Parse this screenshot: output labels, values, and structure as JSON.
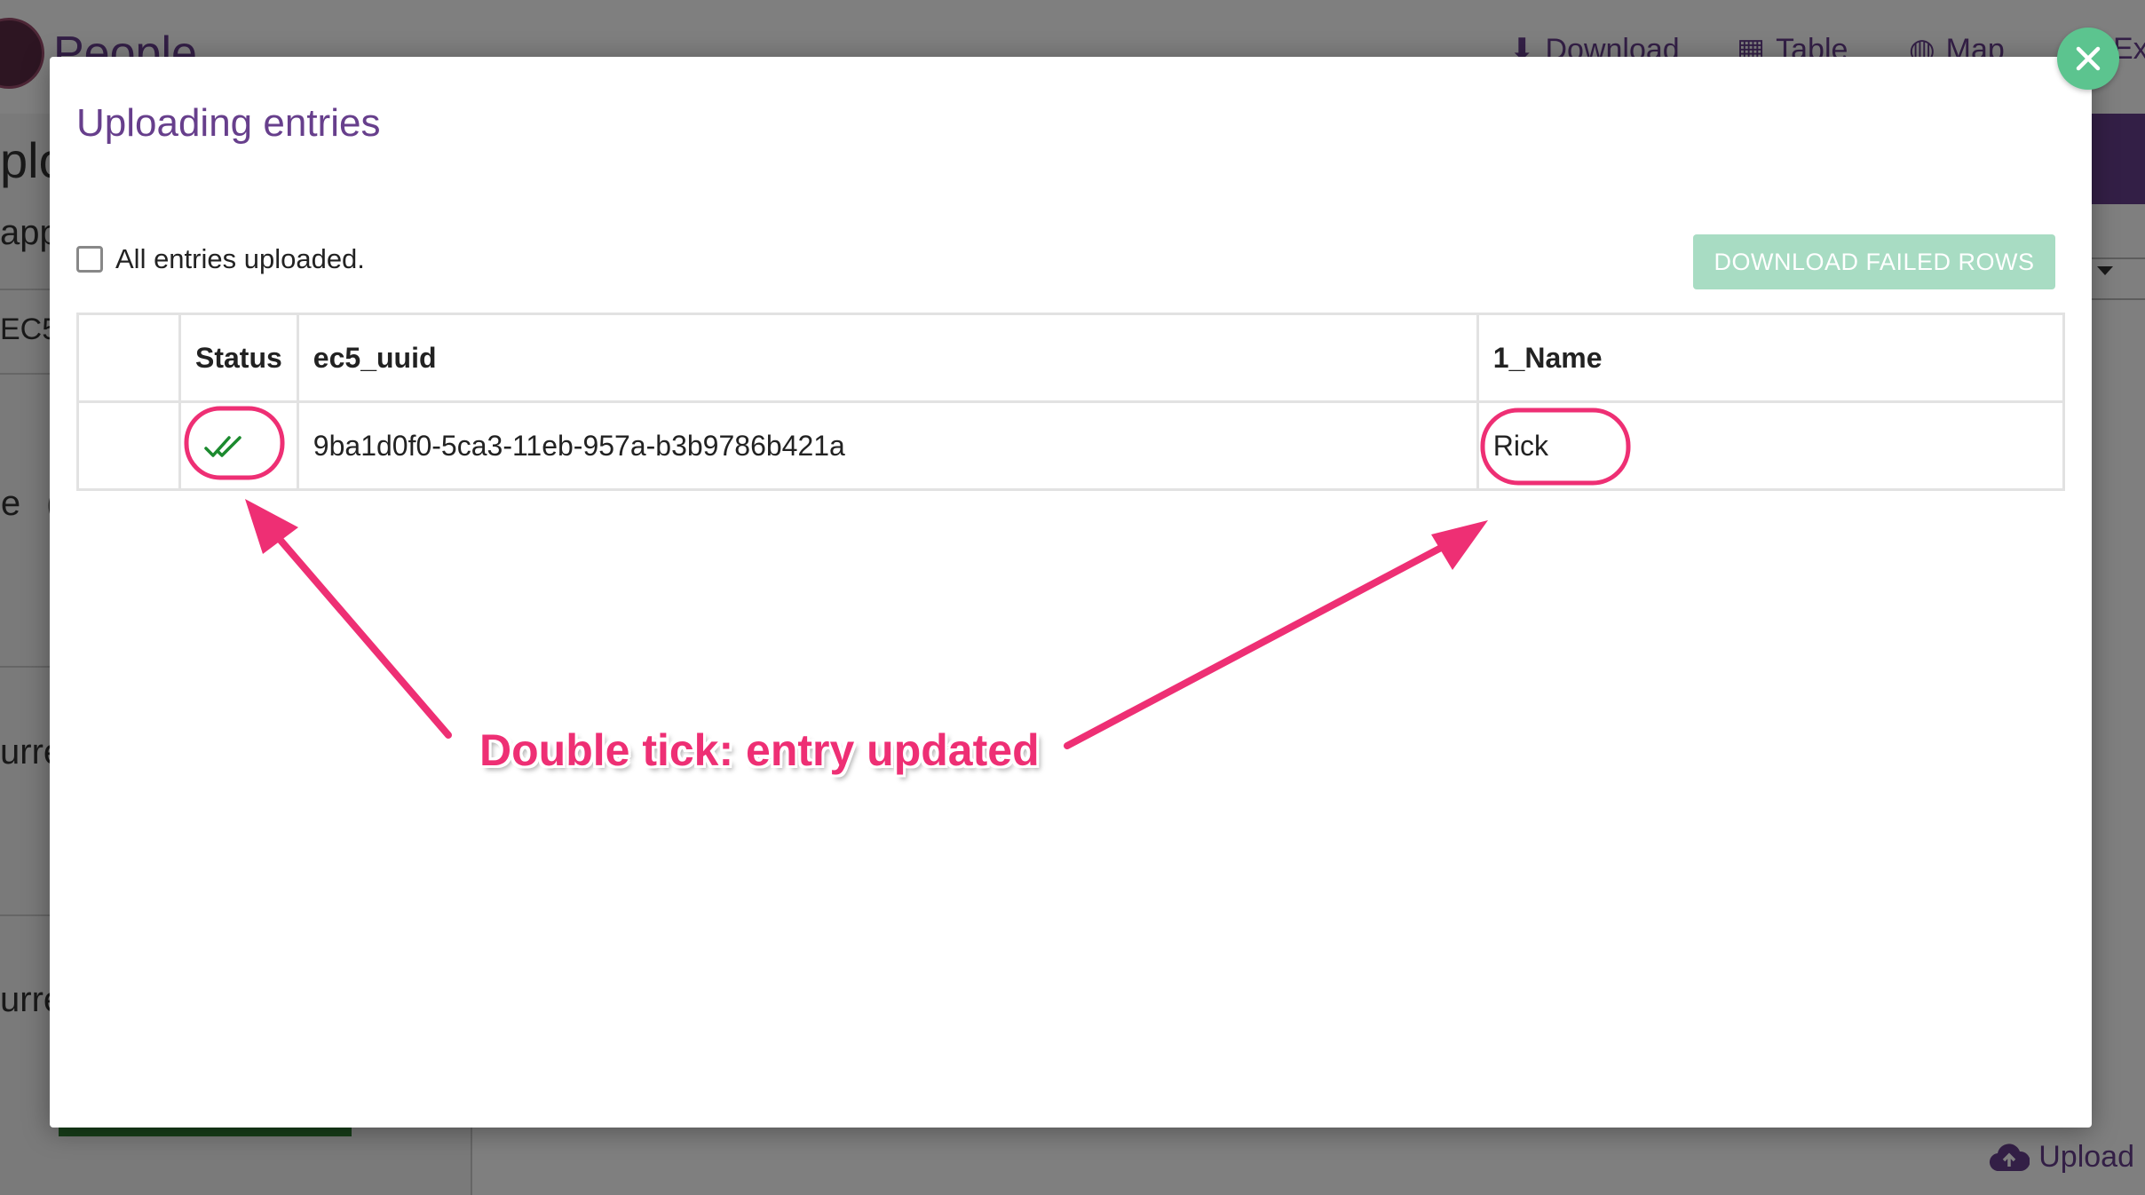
{
  "background": {
    "app_title": "People",
    "nav": [
      "Download",
      "Table",
      "Map",
      "Ex"
    ],
    "side_fragments": [
      "plo",
      "appi",
      "EC5",
      "e (.",
      "urre",
      "urre"
    ],
    "upload_label": "Upload"
  },
  "modal": {
    "title": "Uploading entries",
    "checkbox_label": "All entries uploaded.",
    "checkbox_checked": false,
    "download_button": "DOWNLOAD FAILED ROWS",
    "table": {
      "headers": [
        "",
        "Status",
        "ec5_uuid",
        "1_Name"
      ],
      "rows": [
        {
          "status_icon": "double-check-icon",
          "uuid": "9ba1d0f0-5ca3-11eb-957a-b3b9786b421a",
          "name": "Rick"
        }
      ]
    }
  },
  "annotation": {
    "text": "Double tick: entry updated",
    "color": "#ee2f74"
  },
  "colors": {
    "brand_purple": "#673f8c",
    "close_button": "#5cc48f",
    "download_button_bg": "#a8dcc3",
    "check_green": "#1b8a2e"
  }
}
